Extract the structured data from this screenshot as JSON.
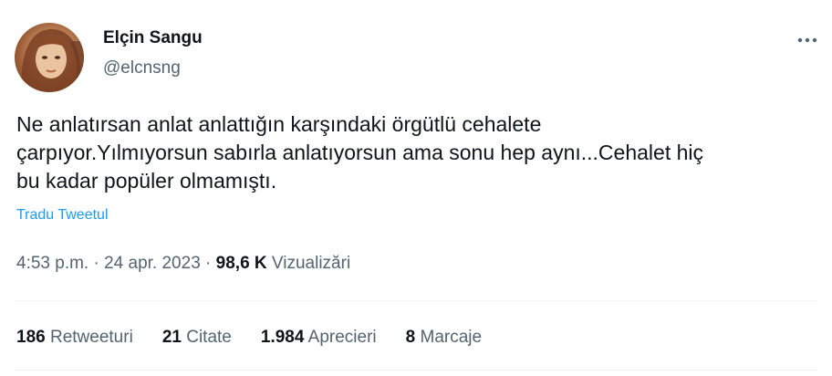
{
  "author": {
    "display_name": "Elçin Sangu",
    "handle": "@elcnsng",
    "avatar_icon": "profile-photo"
  },
  "more_icon": "more-horizontal-icon",
  "tweet": {
    "text": "Ne anlatırsan anlat anlattığın karşındaki örgütlü cehalete\nçarpıyor.Yılmıyorsun sabırla anlatıyorsun ama sonu hep aynı...Cehalet hiç\nbu kadar popüler olmamıştı.",
    "translate_label": "Tradu Tweetul"
  },
  "meta": {
    "time": "4:53 p.m.",
    "sep1": "·",
    "date": "24 apr. 2023",
    "sep2": "·",
    "views_count": "98,6 K",
    "views_label": "Vizualizări"
  },
  "stats": [
    {
      "count": "186",
      "label": "Retweeturi"
    },
    {
      "count": "21",
      "label": "Citate"
    },
    {
      "count": "1.984",
      "label": "Aprecieri"
    },
    {
      "count": "8",
      "label": "Marcaje"
    }
  ],
  "colors": {
    "text": "#0f1419",
    "secondary": "#536471",
    "link": "#1d9bf0",
    "divider": "#eff3f4"
  }
}
